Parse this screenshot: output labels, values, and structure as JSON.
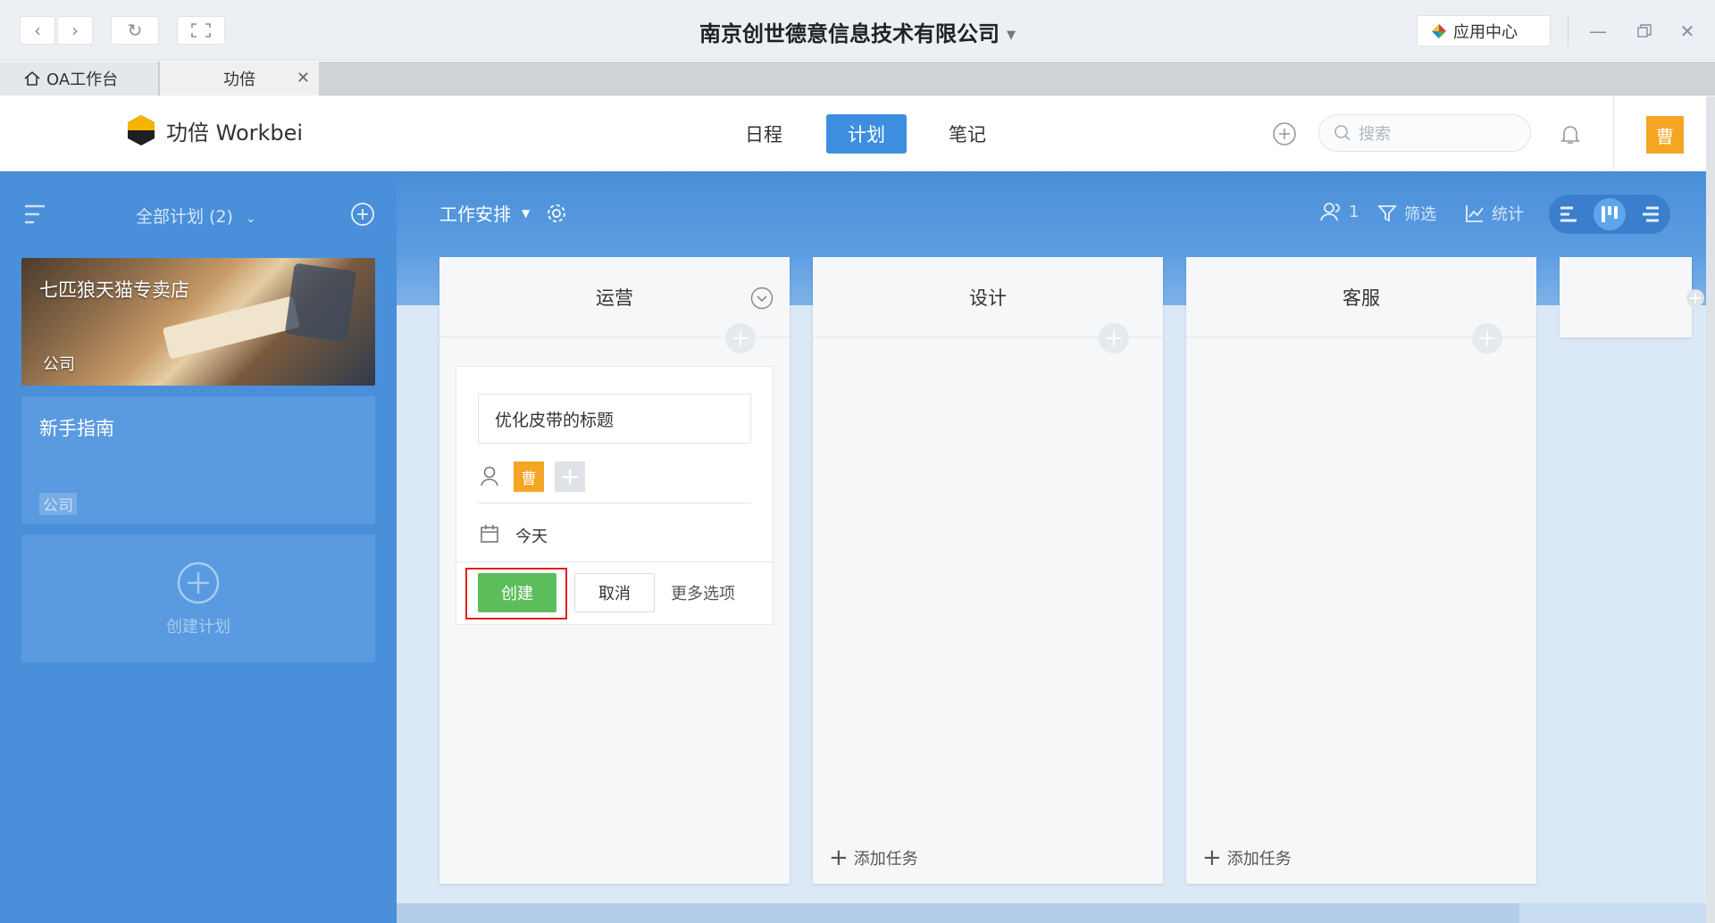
{
  "titlebar": {
    "title": "南京创世德意信息技术有限公司",
    "app_center": "应用中心"
  },
  "tabs": [
    {
      "label": "OA工作台"
    },
    {
      "label": "功倍"
    }
  ],
  "header": {
    "brand": "功倍 Workbei",
    "nav": [
      "日程",
      "计划",
      "笔记"
    ],
    "active_nav": "计划",
    "search_placeholder": "搜索",
    "avatar": "曹"
  },
  "sidebar": {
    "filter": "全部计划 (2)",
    "plans": [
      {
        "title": "七匹狼天猫专卖店",
        "tag": "公司"
      },
      {
        "title": "新手指南",
        "tag": "公司"
      }
    ],
    "create_label": "创建计划"
  },
  "board": {
    "view_name": "工作安排",
    "members_count": "1",
    "filter_label": "筛选",
    "stats_label": "统计",
    "columns": [
      {
        "title": "运营"
      },
      {
        "title": "设计",
        "add_task": "添加任务"
      },
      {
        "title": "客服",
        "add_task": "添加任务"
      }
    ],
    "new_task": {
      "title_value": "优化皮带的标题",
      "assignee": "曹",
      "due": "今天",
      "create": "创建",
      "cancel": "取消",
      "more": "更多选项"
    }
  },
  "colors": {
    "accent": "#3e8ee0",
    "sidebar": "#4a8fd9",
    "create_button": "#5cbe5b",
    "avatar": "#f5a524",
    "highlight": "#e02020"
  }
}
